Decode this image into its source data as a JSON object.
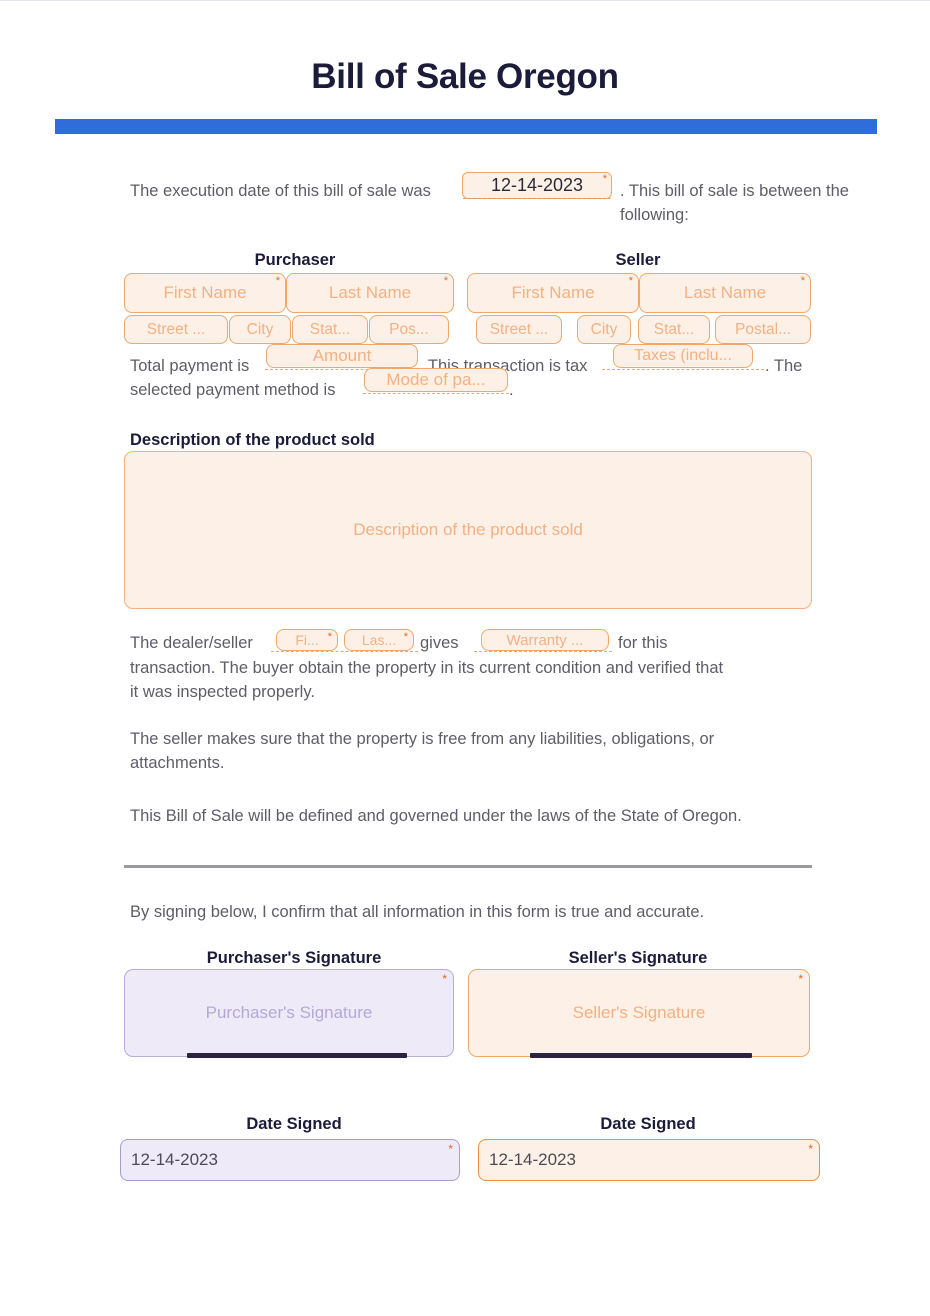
{
  "document": {
    "title": "Bill of Sale Oregon",
    "accent_color": "#2f6ddb",
    "field_fill": "#fdf1e7",
    "field_border": "#f0a86a",
    "field_text": "#f3b184",
    "signature_purple_fill": "#eeeaf8",
    "required_marker": "*"
  },
  "intro": {
    "before_date": "The execution date of this bill of sale was",
    "date_value": "12-14-2023",
    "after_date": ". This bill of sale is between the following:"
  },
  "purchaser": {
    "heading": "Purchaser",
    "first_name": "First Name",
    "last_name": "Last Name",
    "street": "Street ...",
    "city": "City",
    "state": "Stat...",
    "postal": "Pos..."
  },
  "seller": {
    "heading": "Seller",
    "first_name": "First Name",
    "last_name": "Last Name",
    "street": "Street ...",
    "city": "City",
    "state": "Stat...",
    "postal": "Postal..."
  },
  "payment": {
    "lead": "Total payment is",
    "amount": "Amount",
    "mid": ". This transaction is tax",
    "taxes": "Taxes (inclu...",
    "tail": ". The",
    "second_lead": "selected payment method is",
    "mode": "Mode of pa...",
    "period": "."
  },
  "description": {
    "label": "Description of the product sold",
    "placeholder": "Description of the product sold"
  },
  "warranty": {
    "lead": "The dealer/seller",
    "first_name": "Fi...",
    "last_name": "Las...",
    "gives": "gives",
    "warranty": "Warranty ...",
    "tail_line1": "for this",
    "tail_line2": "transaction. The buyer obtain the property in its current condition and verified that",
    "tail_line3": "it was inspected properly."
  },
  "clauses": {
    "liabilities": "The seller makes sure that the property is free from any liabilities, obligations, or attachments.",
    "governing_law": "This Bill of Sale will be defined and governed under the laws of the State of Oregon.",
    "confirmation": "By signing below, I confirm that all information in this form is true and accurate."
  },
  "signatures": {
    "purchaser_label": "Purchaser's Signature",
    "purchaser_placeholder": "Purchaser's Signature",
    "seller_label": "Seller's Signature",
    "seller_placeholder": "Seller's Signature",
    "purchaser_date_label": "Date Signed",
    "purchaser_date_value": "12-14-2023",
    "seller_date_label": "Date Signed",
    "seller_date_value": "12-14-2023"
  }
}
